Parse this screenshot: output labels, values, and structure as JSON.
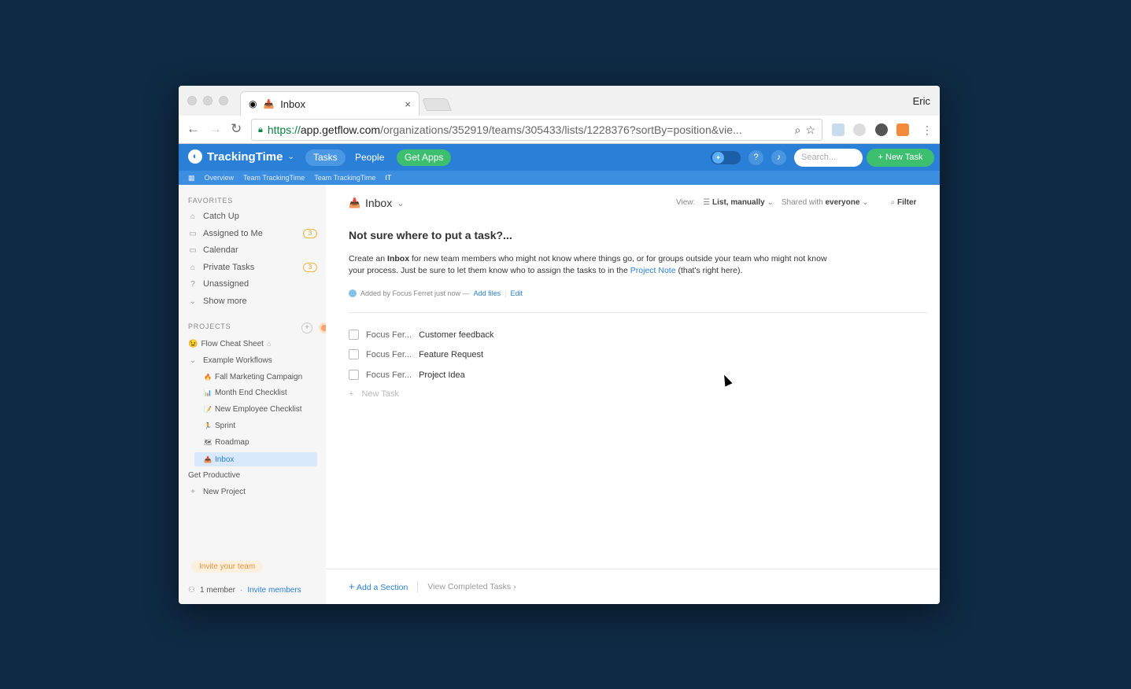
{
  "browser": {
    "tab_title": "Inbox",
    "tab_close": "×",
    "user": "Eric",
    "url_https": "https://",
    "url_domain": "app.getflow.com",
    "url_path": "/organizations/352919/teams/305433/lists/1228376?sortBy=position&vie..."
  },
  "app": {
    "logo": "TrackingTime",
    "nav": [
      "Tasks",
      "People",
      "Get Apps"
    ],
    "search_placeholder": "Search...",
    "new_task": "+ New Task",
    "help": "?",
    "colors": {
      "header": "#2a7fd6",
      "green": "#3cbf6e",
      "accent": "#2a7fd6"
    }
  },
  "breadcrumbs": [
    "Overview",
    "Team TrackingTime",
    "Team TrackingTime",
    "IT"
  ],
  "sidebar": {
    "favorites_label": "FAVORITES",
    "favorites": [
      {
        "label": "Catch Up",
        "icon": "tag-icon"
      },
      {
        "label": "Assigned to Me",
        "icon": "calendar-icon",
        "badge": "3"
      },
      {
        "label": "Calendar",
        "icon": "calendar-icon"
      },
      {
        "label": "Private Tasks",
        "icon": "lock-icon",
        "badge": "3"
      },
      {
        "label": "Unassigned",
        "icon": "question-icon"
      },
      {
        "label": "Show more",
        "icon": "chevron-down-icon"
      }
    ],
    "projects_label": "PROJECTS",
    "projects": [
      {
        "label": "Flow Cheat Sheet",
        "emoji": "😉"
      },
      {
        "label": "Example Workflows",
        "emoji": "⌄"
      }
    ],
    "subprojects": [
      {
        "label": "Fall Marketing Campaign",
        "emoji": "🔥"
      },
      {
        "label": "Month End Checklist",
        "emoji": "📊"
      },
      {
        "label": "New Employee Checklist",
        "emoji": "📝"
      },
      {
        "label": "Sprint",
        "emoji": "🏃"
      },
      {
        "label": "Roadmap",
        "emoji": "🗺"
      },
      {
        "label": "Inbox",
        "emoji": "📥"
      }
    ],
    "get_productive": "Get Productive",
    "new_project": "New Project",
    "invite_note": "Invite your team",
    "members": "1 member",
    "invite_members": "Invite members"
  },
  "main": {
    "title": "Inbox",
    "view_label": "View:",
    "view_value": "List, manually",
    "shared_label": "Shared with",
    "shared_value": "everyone",
    "filter": "Filter",
    "headline": "Not sure where to put a task?...",
    "desc_1": "Create an ",
    "desc_bold": "Inbox",
    "desc_2": " for new team members who might not know where things go, or for groups outside your team who might not know your process. Just be sure to let them know who to assign the tasks to in the ",
    "desc_link": "Project Note",
    "desc_3": " (that's right here).",
    "meta": "Added by Focus  Ferret just now —",
    "add_files": "Add files",
    "edit": "Edit",
    "tasks": [
      {
        "who": "Focus  Fer...",
        "title": "Customer feedback"
      },
      {
        "who": "Focus  Fer...",
        "title": "Feature Request"
      },
      {
        "who": "Focus  Fer...",
        "title": "Project Idea"
      }
    ],
    "new_task": "New Task",
    "add_section": "Add a Section",
    "view_completed": "View Completed Tasks"
  }
}
